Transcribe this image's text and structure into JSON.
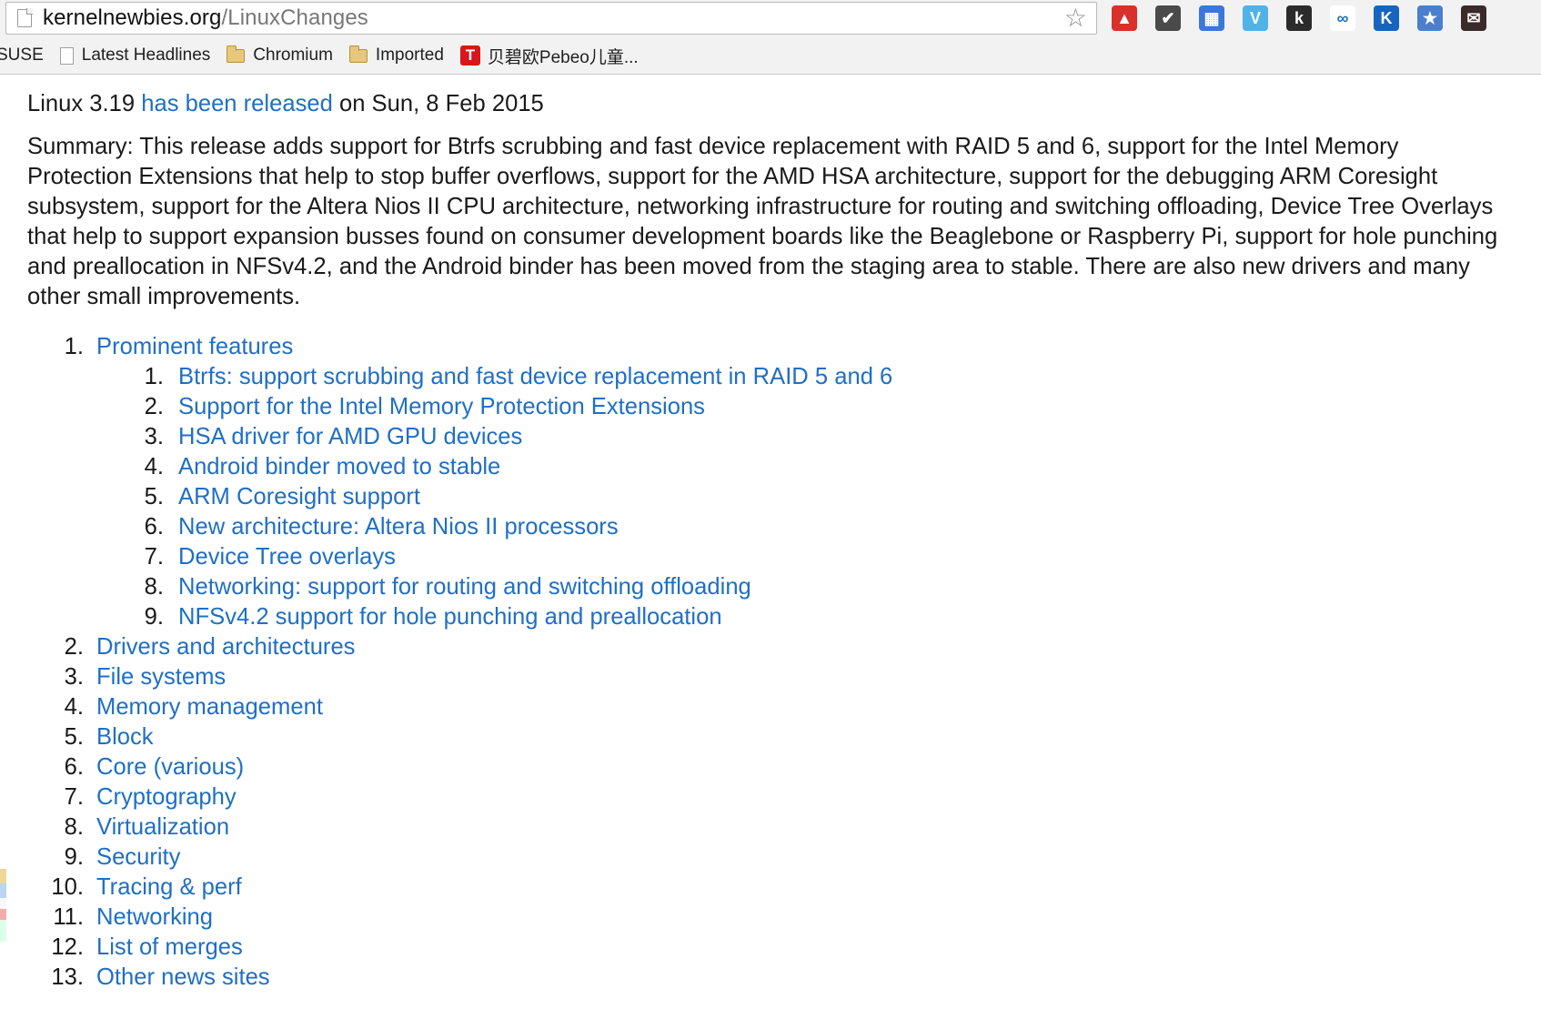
{
  "browser": {
    "url_host": "kernelnewbies.org",
    "url_path": "/LinuxChanges",
    "extensions": [
      {
        "icon": "acrobat-icon",
        "color": "#d9302c",
        "glyph": "▲"
      },
      {
        "icon": "pocket-icon",
        "color": "#4a4a4a",
        "glyph": "✔"
      },
      {
        "icon": "calendar-icon",
        "color": "#3b78d8",
        "glyph": "▦"
      },
      {
        "icon": "vimeo-icon",
        "color": "#4fb3e8",
        "glyph": "V"
      },
      {
        "icon": "k-icon",
        "color": "#2b2b2b",
        "glyph": "k"
      },
      {
        "icon": "infinity-icon",
        "color": "#ffffff",
        "glyph": "∞"
      },
      {
        "icon": "k-blue-icon",
        "color": "#1565c0",
        "glyph": "K"
      },
      {
        "icon": "star-badge-icon",
        "color": "#4a7fd0",
        "glyph": "★"
      },
      {
        "icon": "cat-mail-icon",
        "color": "#3a2a2a",
        "glyph": "✉"
      }
    ],
    "bookmarks": [
      {
        "label": "SUSE",
        "type": "none"
      },
      {
        "label": "Latest Headlines",
        "type": "page"
      },
      {
        "label": "Chromium",
        "type": "folder"
      },
      {
        "label": "Imported",
        "type": "folder"
      },
      {
        "label": "贝碧欧Pebeo儿童...",
        "type": "t-icon"
      }
    ]
  },
  "article": {
    "release_prefix": "Linux 3.19 ",
    "release_link": "has been released",
    "release_suffix": " on Sun, 8 Feb 2015",
    "summary": "Summary: This release adds support for Btrfs scrubbing and fast device replacement with RAID 5 and 6, support for the Intel Memory Protection Extensions that help to stop buffer overflows, support for the AMD HSA architecture, support for the debugging ARM Coresight subsystem, support for the Altera Nios II CPU architecture, networking infrastructure for routing and switching offloading, Device Tree Overlays that help to support expansion busses found on consumer development boards like the Beaglebone or Raspberry Pi, support for hole punching and preallocation in NFSv4.2, and the Android binder has been moved from the staging area to stable. There are also new drivers and many other small improvements.",
    "toc": [
      {
        "num": "1.",
        "label": "Prominent features",
        "children": [
          {
            "num": "1.",
            "label": "Btrfs: support scrubbing and fast device replacement in RAID 5 and 6"
          },
          {
            "num": "2.",
            "label": "Support for the Intel Memory Protection Extensions"
          },
          {
            "num": "3.",
            "label": "HSA driver for AMD GPU devices"
          },
          {
            "num": "4.",
            "label": "Android binder moved to stable"
          },
          {
            "num": "5.",
            "label": "ARM Coresight support"
          },
          {
            "num": "6.",
            "label": "New architecture: Altera Nios II processors"
          },
          {
            "num": "7.",
            "label": "Device Tree overlays"
          },
          {
            "num": "8.",
            "label": "Networking: support for routing and switching offloading"
          },
          {
            "num": "9.",
            "label": "NFSv4.2 support for hole punching and preallocation"
          }
        ]
      },
      {
        "num": "2.",
        "label": "Drivers and architectures"
      },
      {
        "num": "3.",
        "label": "File systems"
      },
      {
        "num": "4.",
        "label": "Memory management"
      },
      {
        "num": "5.",
        "label": "Block"
      },
      {
        "num": "6.",
        "label": "Core (various)"
      },
      {
        "num": "7.",
        "label": "Cryptography"
      },
      {
        "num": "8.",
        "label": "Virtualization"
      },
      {
        "num": "9.",
        "label": "Security"
      },
      {
        "num": "10.",
        "label": "Tracing & perf"
      },
      {
        "num": "11.",
        "label": "Networking"
      },
      {
        "num": "12.",
        "label": "List of merges"
      },
      {
        "num": "13.",
        "label": "Other news sites"
      }
    ]
  }
}
